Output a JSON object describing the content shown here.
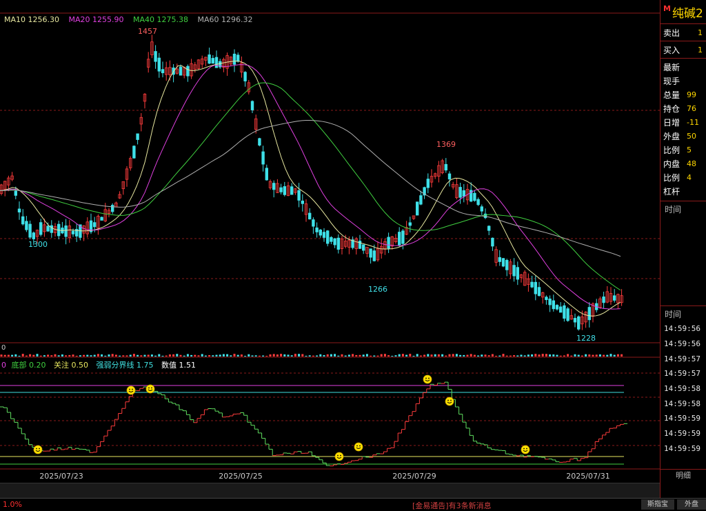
{
  "legend": {
    "ma10": "MA10 1256.30",
    "ma20": "MA20 1255.90",
    "ma40": "MA40 1275.38",
    "ma60": "MA60 1296.32"
  },
  "price_labels": {
    "high1": "1457",
    "low1": "1300",
    "high2": "1369",
    "low2": "1266",
    "low3": "1228"
  },
  "indicator_legend": {
    "partial": "0",
    "bottom": "底部 0.20",
    "attention": "关注 0.50",
    "strength_line": "强弱分界线 1.75",
    "value": "数值 1.51"
  },
  "volume_partial": "0",
  "dates": [
    "2025/07/23",
    "2025/07/25",
    "2025/07/29",
    "2025/07/31"
  ],
  "panel": {
    "m_badge": "M",
    "name": "纯碱2",
    "sell": {
      "label": "卖出",
      "value": "1"
    },
    "buy": {
      "label": "买入",
      "value": "1"
    },
    "rows": [
      {
        "label": "最新",
        "value": ""
      },
      {
        "label": "现手",
        "value": ""
      },
      {
        "label": "总量",
        "value": "99"
      },
      {
        "label": "持仓",
        "value": "76"
      },
      {
        "label": "日增",
        "value": "-11"
      },
      {
        "label": "外盘",
        "value": "50"
      },
      {
        "label": "比例",
        "value": "5"
      },
      {
        "label": "内盘",
        "value": "48"
      },
      {
        "label": "比例",
        "value": "4"
      },
      {
        "label": "杠杆",
        "value": ""
      }
    ],
    "time_label_1": "时间",
    "time_label_2": "时间",
    "ticks": [
      "14:59:56",
      "14:59:56",
      "14:59:57",
      "14:59:57",
      "14:59:58",
      "14:59:58",
      "14:59:59",
      "14:59:59",
      "14:59:59"
    ],
    "tab_label": "明细"
  },
  "status": {
    "left": "1.0%",
    "message": "[金易通告]有3条新消息",
    "btn1": "斯指宝",
    "btn2": "外盘"
  },
  "colors": {
    "up": "#ff3c3c",
    "down": "#3ee0e8",
    "ma10": "#e8e8a0",
    "ma20": "#e040e0",
    "ma40": "#40d040",
    "ma60": "#b0b0b0",
    "gold": "#ffd700",
    "grid": "#8b1a1a"
  }
}
